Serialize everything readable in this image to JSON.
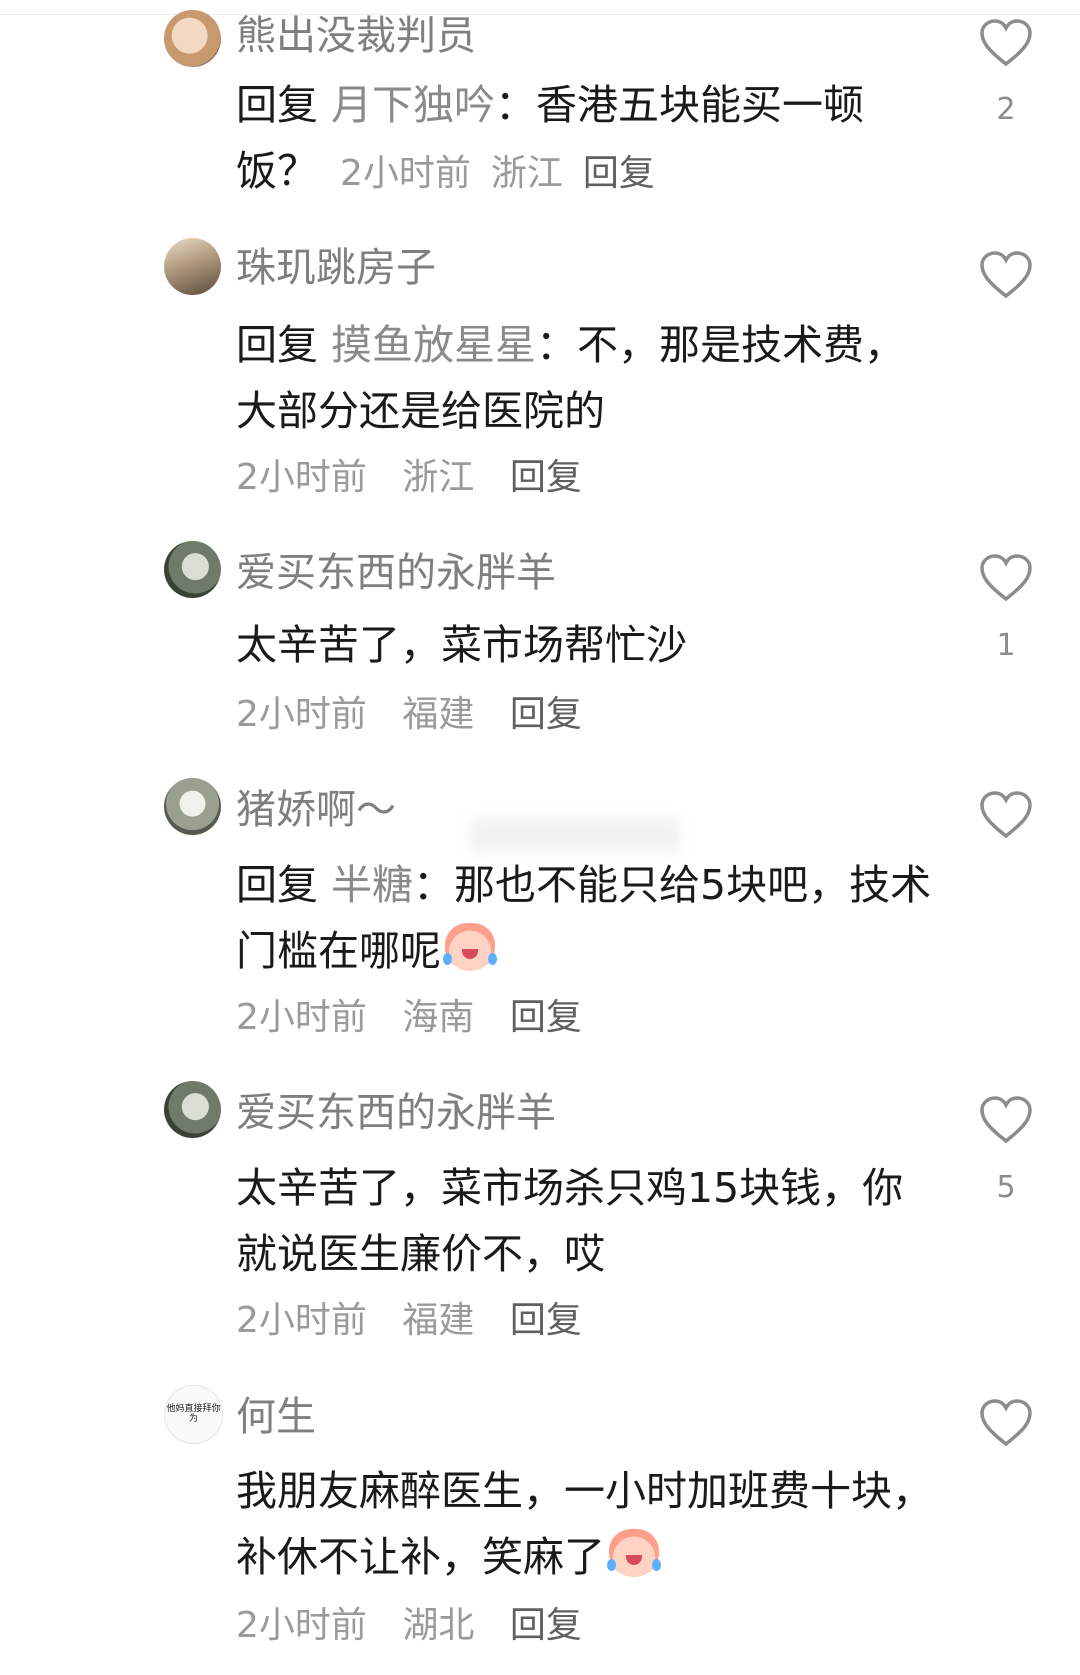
{
  "comments": [
    {
      "username": "熊出没裁判员",
      "reply_prefix": "回复",
      "reply_target": "月下独吟",
      "text": "：香港五块能买一顿饭？",
      "time": "2小时前",
      "location": "浙江",
      "reply_label": "回复",
      "likes": "2"
    },
    {
      "username": "珠玑跳房子",
      "reply_prefix": "回复",
      "reply_target": "摸鱼放星星",
      "text": "：不，那是技术费，大部分还是给医院的",
      "time": "2小时前",
      "location": "浙江",
      "reply_label": "回复",
      "likes": ""
    },
    {
      "username": "爱买东西的永胖羊",
      "text": "太辛苦了，菜市场帮忙沙",
      "time": "2小时前",
      "location": "福建",
      "reply_label": "回复",
      "likes": "1"
    },
    {
      "username": "猪娇啊～",
      "reply_prefix": "回复",
      "reply_target": "半糖",
      "text": "：那也不能只给5块吧，技术门槛在哪呢",
      "emoji": "crying-laugh-emoji",
      "time": "2小时前",
      "location": "海南",
      "reply_label": "回复",
      "likes": ""
    },
    {
      "username": "爱买东西的永胖羊",
      "text": "太辛苦了，菜市场杀只鸡15块钱，你就说医生廉价不，哎",
      "time": "2小时前",
      "location": "福建",
      "reply_label": "回复",
      "likes": "5"
    },
    {
      "username": "何生",
      "text": "我朋友麻醉医生，一小时加班费十块，补休不让补，笑麻了",
      "emoji": "crying-laugh-emoji",
      "time": "2小时前",
      "location": "湖北",
      "reply_label": "回复",
      "likes": ""
    }
  ],
  "avatar6_text": "他妈直接拜你为",
  "colors": {
    "username": "#7f7f7f",
    "body": "#1a1a1a",
    "meta": "#9a9a9a",
    "heart_stroke": "#8c8c8c"
  }
}
